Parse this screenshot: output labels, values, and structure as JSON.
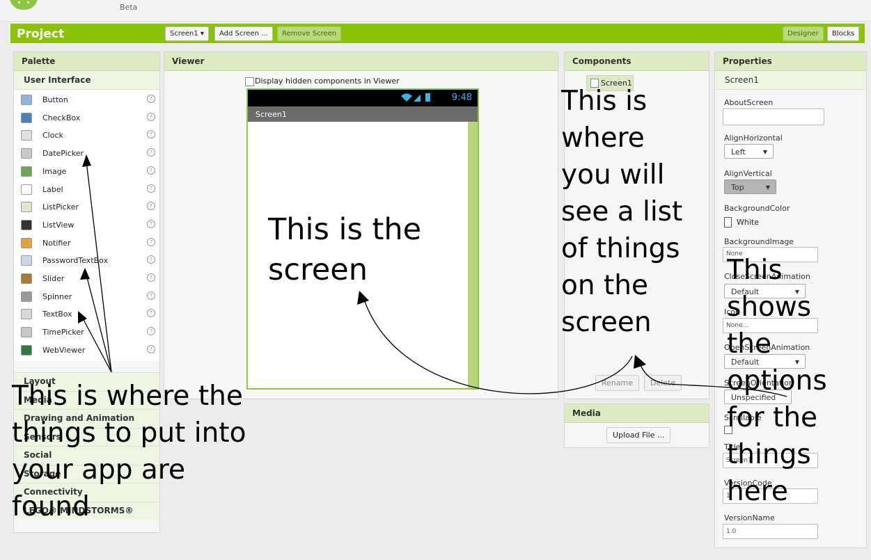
{
  "header": {
    "beta_label": "Beta",
    "project_title": "Project",
    "screen_select": "Screen1 ▾",
    "add_screen": "Add Screen ...",
    "remove_screen": "Remove Screen",
    "designer": "Designer",
    "blocks": "Blocks"
  },
  "palette": {
    "title": "Palette",
    "group": "User Interface",
    "items": [
      {
        "label": "Button",
        "icon": "button-icon",
        "color": "#8fb6d8"
      },
      {
        "label": "CheckBox",
        "icon": "checkbox-icon",
        "color": "#4a7fc0"
      },
      {
        "label": "Clock",
        "icon": "clock-icon",
        "color": "#e0e0e0"
      },
      {
        "label": "DatePicker",
        "icon": "datepicker-icon",
        "color": "#c8c8c8"
      },
      {
        "label": "Image",
        "icon": "image-icon",
        "color": "#6aa84f"
      },
      {
        "label": "Label",
        "icon": "label-icon",
        "color": "#ffffff"
      },
      {
        "label": "ListPicker",
        "icon": "listpicker-icon",
        "color": "#dfe7c8"
      },
      {
        "label": "ListView",
        "icon": "listview-icon",
        "color": "#333333"
      },
      {
        "label": "Notifier",
        "icon": "notifier-icon",
        "color": "#e2a33a"
      },
      {
        "label": "PasswordTextBox",
        "icon": "password-icon",
        "color": "#c9d7e6"
      },
      {
        "label": "Slider",
        "icon": "slider-icon",
        "color": "#b07a2e"
      },
      {
        "label": "Spinner",
        "icon": "spinner-icon",
        "color": "#9a9a9a"
      },
      {
        "label": "TextBox",
        "icon": "textbox-icon",
        "color": "#d9d9d9"
      },
      {
        "label": "TimePicker",
        "icon": "timepicker-icon",
        "color": "#c8c8c8"
      },
      {
        "label": "WebViewer",
        "icon": "webviewer-icon",
        "color": "#2f7a3b"
      }
    ],
    "help_glyph": "?",
    "categories": [
      "Layout",
      "Media",
      "Drawing and Animation",
      "Sensors",
      "Social",
      "Storage",
      "Connectivity",
      "LEGO® MINDSTORMS®"
    ]
  },
  "viewer": {
    "title": "Viewer",
    "hidden_toggle": "Display hidden components in Viewer",
    "status_time": "9:48",
    "status_icons": "wifi-signal-battery",
    "screen_title": "Screen1"
  },
  "components": {
    "title": "Components",
    "tree_item": "Screen1",
    "rename": "Rename",
    "delete": "Delete"
  },
  "media": {
    "title": "Media",
    "upload": "Upload File ..."
  },
  "properties": {
    "title": "Properties",
    "target": "Screen1",
    "about_screen": "AboutScreen",
    "align_horizontal": "AlignHorizontal",
    "align_horizontal_value": "Left",
    "align_vertical": "AlignVertical",
    "align_vertical_value": "Top",
    "background_color": "BackgroundColor",
    "background_color_value": "White",
    "background_image": "BackgroundImage",
    "background_image_value": "None",
    "close_screen_animation": "CloseScreenAnimation",
    "close_screen_animation_value": "Default",
    "icon_label": "Icon",
    "icon_value": "None...",
    "open_screen_animation": "OpenScreenAnimation",
    "open_screen_animation_value": "Default",
    "screen_orientation": "ScreenOrientation",
    "screen_orientation_value": "Unspecified",
    "scrollable": "Scrollable",
    "title_label": "Title",
    "title_value": "Screen1",
    "version_code": "VersionCode",
    "version_code_value": "1",
    "version_name": "VersionName",
    "version_name_value": "1.0"
  },
  "annotations": {
    "palette_note": [
      "This is where the",
      "things to put into",
      "your app are",
      "found"
    ],
    "screen_note": [
      "This is the",
      "screen"
    ],
    "components_note": [
      "This is",
      "where",
      "you will",
      "see a list",
      "of things",
      "on the",
      "screen"
    ],
    "properties_note": [
      "This",
      "shows",
      "the",
      "options",
      "for the",
      "things",
      "here"
    ]
  },
  "colors": {
    "brand_green": "#89c306",
    "panel_header": "#dcebc2",
    "phone_border": "#8dc63f"
  }
}
